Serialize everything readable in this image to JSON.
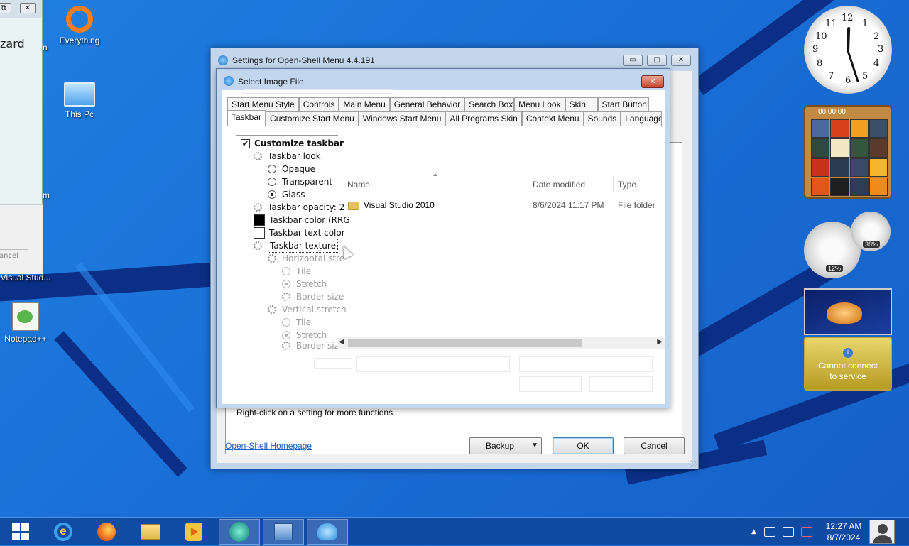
{
  "desktop": {
    "icons": [
      {
        "label": "Everything",
        "icon": "everything-icon"
      },
      {
        "label": "This Pc",
        "icon": "computer-icon"
      },
      {
        "label": "Visual Stud...",
        "icon": "visual-studio-icon"
      },
      {
        "label": "Notepad++",
        "icon": "notepadpp-icon"
      }
    ],
    "partial_labels": {
      "edge_n": "n",
      "edge_m": "m"
    }
  },
  "left_window": {
    "title_text": "zard",
    "cancel_label": "ancel",
    "buttons": {
      "restore": "⧉",
      "close": "✕"
    }
  },
  "settings": {
    "title": "Settings for Open-Shell Menu 4.4.191",
    "caption_buttons": {
      "minimize": "▭",
      "maximize": "□",
      "close": "✕"
    },
    "tabs_row1": [
      "Start Menu Style",
      "Controls",
      "Main Menu",
      "General Behavior",
      "Search Box",
      "Menu Look",
      "Skin",
      "Start Button"
    ],
    "tabs_row2": [
      "Taskbar",
      "Customize Start Menu",
      "Windows Start Menu",
      "All Programs Skin",
      "Context Menu",
      "Sounds",
      "Language"
    ],
    "tree": {
      "customize_taskbar": "Customize taskbar",
      "taskbar_look": "Taskbar look",
      "opaque": "Opaque",
      "transparent": "Transparent",
      "glass": "Glass",
      "taskbar_opacity": "Taskbar opacity: 2",
      "taskbar_color": "Taskbar color (RRG",
      "taskbar_text_color": "Taskbar text color",
      "taskbar_texture": "Taskbar texture",
      "horizontal_stretch": "Horizontal stre",
      "tile1": "Tile",
      "stretch1": "Stretch",
      "border_size1": "Border size",
      "vertical_stretch": "Vertical stretch",
      "tile2": "Tile",
      "stretch2": "Stretch",
      "border_size2": "Border size"
    },
    "hint": "Right-click on a setting for more functions",
    "homepage_link": "Open-Shell Homepage",
    "backup_label": "Backup",
    "ok_label": "OK",
    "cancel_label": "Cancel"
  },
  "file_dialog": {
    "title": "Select Image File",
    "close": "✕",
    "columns": [
      "Name",
      "Date modified",
      "Type"
    ],
    "rows": [
      {
        "name": "Visual Studio 2010",
        "date": "8/6/2024 11:17 PM",
        "type": "File folder"
      }
    ]
  },
  "gadgets": {
    "clock_numbers": [
      "12",
      "1",
      "2",
      "3",
      "4",
      "5",
      "6",
      "7",
      "8",
      "9",
      "10",
      "11"
    ],
    "puzzle_timer": "00:00:00",
    "cpu_percent": "12%",
    "ram_percent": "38%",
    "weather_message": "Cannot connect to service"
  },
  "taskbar": {
    "time": "12:27 AM",
    "date": "8/7/2024"
  }
}
